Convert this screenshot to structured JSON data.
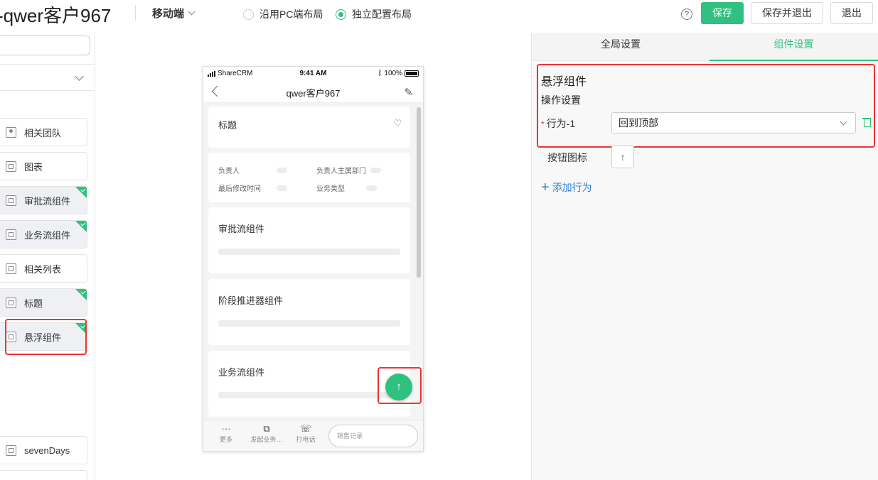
{
  "header": {
    "title": "-qwer客户967",
    "device": "移动端",
    "layout_options": [
      "沿用PC端布局",
      "独立配置布局"
    ],
    "layout_selected": "独立配置布局",
    "help": "?",
    "save": "保存",
    "save_exit": "保存并退出",
    "exit": "退出"
  },
  "sidebar": {
    "components": [
      {
        "label": "相关团队",
        "used": false
      },
      {
        "label": "图表",
        "used": false
      },
      {
        "label": "审批流组件",
        "used": true
      },
      {
        "label": "业务流组件",
        "used": true
      },
      {
        "label": "相关列表",
        "used": false
      },
      {
        "label": "标题",
        "used": true
      },
      {
        "label": "悬浮组件",
        "used": true
      },
      {
        "label": "sevenDays",
        "used": false
      }
    ]
  },
  "phone": {
    "carrier": "ShareCRM",
    "time": "9:41 AM",
    "battery": "100%",
    "nav_title": "qwer客户967",
    "card_title": "标题",
    "fields": [
      "负责人",
      "负责人主属部门",
      "最后修改时间",
      "业务类型"
    ],
    "sections": [
      "审批流组件",
      "阶段推进器组件",
      "业务流组件"
    ],
    "float_icon": "↑",
    "tabs": [
      {
        "icon": "more-icon",
        "glyph": "···",
        "label": "更多"
      },
      {
        "icon": "flow-icon",
        "glyph": "⧉",
        "label": "发起业务…"
      },
      {
        "icon": "phone-icon",
        "glyph": "☏",
        "label": "打电话"
      }
    ],
    "input_placeholder": "销售记录"
  },
  "panel": {
    "tabs": [
      "全局设置",
      "组件设置"
    ],
    "active_tab": "组件设置",
    "heading": "悬浮组件",
    "section": "操作设置",
    "action_label": "行为-1",
    "required_mark": "*",
    "action_value": "回到顶部",
    "button_icon_label": "按钮图标",
    "button_icon_glyph": "↑",
    "add_action": "添加行为"
  },
  "colors": {
    "accent": "#30c07f",
    "highlight": "#e33333",
    "link": "#2f80d7"
  }
}
